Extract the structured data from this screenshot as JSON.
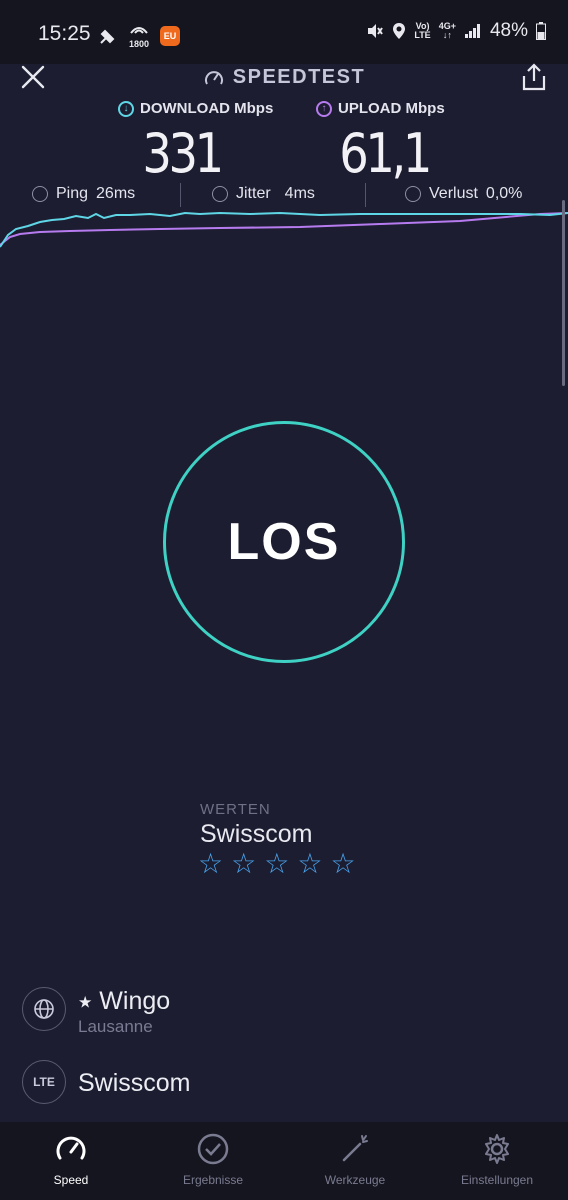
{
  "status_bar": {
    "time": "15:25",
    "carrier_sub": "1800",
    "app_badge": "EU",
    "network_volte": "Vo)",
    "network_lte": "LTE",
    "network_gen": "4G+",
    "battery": "48%"
  },
  "header": {
    "title": "SPEEDTEST"
  },
  "download": {
    "label": "DOWNLOAD Mbps",
    "value": "331",
    "color": "#5fd6e6"
  },
  "upload": {
    "label": "UPLOAD Mbps",
    "value": "61,1",
    "color": "#b77bf0"
  },
  "stats": {
    "ping_label": "Ping",
    "ping_value": "26ms",
    "jitter_label": "Jitter",
    "jitter_value": "4ms",
    "loss_label": "Verlust",
    "loss_value": "0,0%"
  },
  "go_button": {
    "label": "LOS",
    "color": "#3ed1c4"
  },
  "rating": {
    "label": "WERTEN",
    "provider": "Swisscom",
    "stars_total": 5,
    "stars_filled": 0
  },
  "server": {
    "name": "Wingo",
    "location": "Lausanne",
    "icon": "globe-icon"
  },
  "connection": {
    "badge": "LTE",
    "provider": "Swisscom"
  },
  "bottom_nav": {
    "items": [
      {
        "label": "Speed",
        "icon": "speedometer-icon",
        "active": true
      },
      {
        "label": "Ergebnisse",
        "icon": "check-circle-icon",
        "active": false
      },
      {
        "label": "Werkzeuge",
        "icon": "magic-wand-icon",
        "active": false
      },
      {
        "label": "Einstellungen",
        "icon": "gear-icon",
        "active": false
      }
    ]
  }
}
